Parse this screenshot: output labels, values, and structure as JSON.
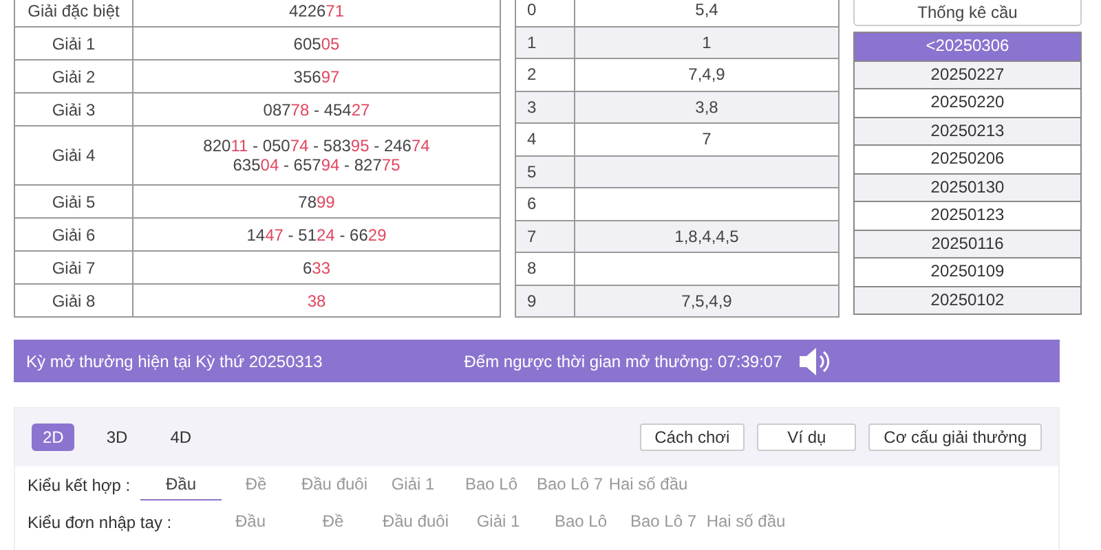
{
  "prizes": [
    {
      "name": "Giải đặc biệt",
      "lines": [
        [
          {
            "head": "4226",
            "tail": "71"
          }
        ]
      ]
    },
    {
      "name": "Giải 1",
      "lines": [
        [
          {
            "head": "605",
            "tail": "05"
          }
        ]
      ]
    },
    {
      "name": "Giải 2",
      "lines": [
        [
          {
            "head": "356",
            "tail": "97"
          }
        ]
      ]
    },
    {
      "name": "Giải 3",
      "lines": [
        [
          {
            "head": "087",
            "tail": "78"
          },
          {
            "head": "454",
            "tail": "27"
          }
        ]
      ]
    },
    {
      "name": "Giải 4",
      "lines": [
        [
          {
            "head": "820",
            "tail": "11"
          },
          {
            "head": "050",
            "tail": "74"
          },
          {
            "head": "583",
            "tail": "95"
          },
          {
            "head": "246",
            "tail": "74"
          }
        ],
        [
          {
            "head": "635",
            "tail": "04"
          },
          {
            "head": "657",
            "tail": "94"
          },
          {
            "head": "827",
            "tail": "75"
          }
        ]
      ]
    },
    {
      "name": "Giải 5",
      "lines": [
        [
          {
            "head": "78",
            "tail": "99"
          }
        ]
      ]
    },
    {
      "name": "Giải 6",
      "lines": [
        [
          {
            "head": "14",
            "tail": "47"
          },
          {
            "head": "51",
            "tail": "24"
          },
          {
            "head": "66",
            "tail": "29"
          }
        ]
      ]
    },
    {
      "name": "Giải 7",
      "lines": [
        [
          {
            "head": "6",
            "tail": "33"
          }
        ]
      ]
    },
    {
      "name": "Giải 8",
      "lines": [
        [
          {
            "tail": "38"
          }
        ]
      ]
    }
  ],
  "separator": " - ",
  "heads": [
    {
      "digit": "0",
      "tails": "5,4"
    },
    {
      "digit": "1",
      "tails": "1"
    },
    {
      "digit": "2",
      "tails": "7,4,9"
    },
    {
      "digit": "3",
      "tails": "3,8"
    },
    {
      "digit": "4",
      "tails": "7"
    },
    {
      "digit": "5"
    },
    {
      "digit": "6"
    },
    {
      "digit": "7",
      "tails": "1,8,4,4,5"
    },
    {
      "digit": "8"
    },
    {
      "digit": "9",
      "tails": "7,5,4,9"
    }
  ],
  "stats_button": "Thống kê cầu",
  "draws": [
    {
      "label": "<20250306",
      "selected": true
    },
    {
      "label": "20250227",
      "selected": false
    },
    {
      "label": "20250220",
      "selected": false
    },
    {
      "label": "20250213",
      "selected": false
    },
    {
      "label": "20250206",
      "selected": false
    },
    {
      "label": "20250130",
      "selected": false
    },
    {
      "label": "20250123",
      "selected": false
    },
    {
      "label": "20250116",
      "selected": false
    },
    {
      "label": "20250109",
      "selected": false
    },
    {
      "label": "20250102",
      "selected": false
    }
  ],
  "banner": {
    "current": "Kỳ mở thưởng hiện tại Kỳ thứ 20250313",
    "countdown": "Đếm ngược thời gian mở thưởng: 07:39:07"
  },
  "game_tabs": [
    {
      "label": "2D",
      "selected": true
    },
    {
      "label": "3D",
      "selected": false
    },
    {
      "label": "4D",
      "selected": false
    }
  ],
  "help_buttons": [
    "Cách chơi",
    "Ví dụ",
    "Cơ cấu giải thưởng"
  ],
  "bet_rows": [
    {
      "label": "Kiểu kết hợp :",
      "options": [
        {
          "label": "Đầu",
          "selected": true
        },
        {
          "label": "Đề",
          "selected": false
        },
        {
          "label": "Đầu đuôi",
          "selected": false
        },
        {
          "label": "Giải 1",
          "selected": false
        },
        {
          "label": "Bao Lô",
          "selected": false
        },
        {
          "label": "Bao Lô 7",
          "selected": false
        },
        {
          "label": "Hai số đầu",
          "selected": false
        }
      ]
    },
    {
      "label": "Kiểu đơn nhập tay :",
      "options": [
        {
          "label": "Đầu",
          "selected": false
        },
        {
          "label": "Đề",
          "selected": false
        },
        {
          "label": "Đầu đuôi",
          "selected": false
        },
        {
          "label": "Giải 1",
          "selected": false
        },
        {
          "label": "Bao Lô",
          "selected": false
        },
        {
          "label": "Bao Lô 7",
          "selected": false
        },
        {
          "label": "Hai số đầu",
          "selected": false
        }
      ]
    }
  ]
}
